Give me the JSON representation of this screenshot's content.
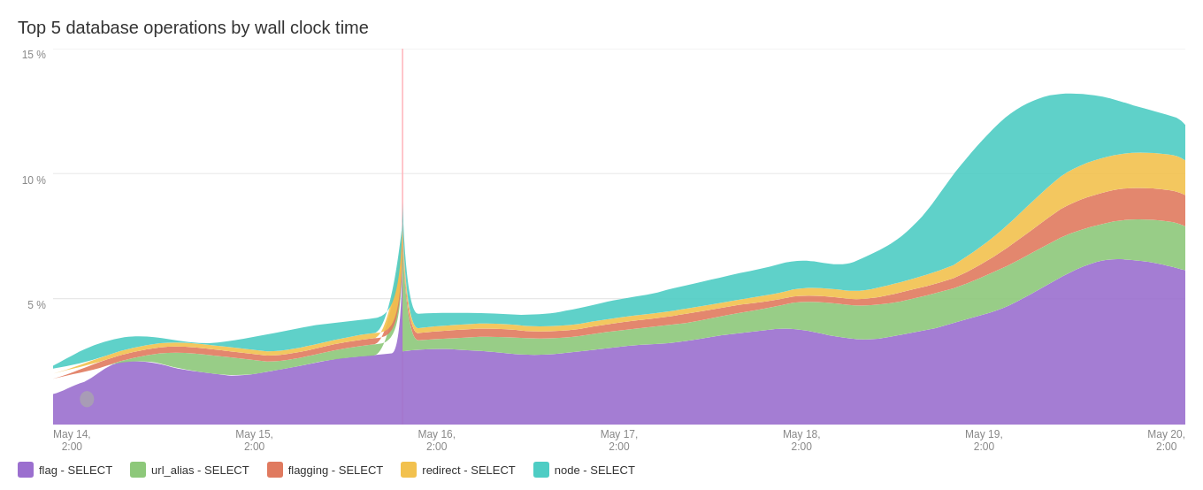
{
  "title": "Top 5 database operations by wall clock time",
  "yAxis": {
    "labels": [
      "15 %",
      "10 %",
      "5 %",
      ""
    ]
  },
  "xAxis": {
    "labels": [
      {
        "line1": "May 14,",
        "line2": "2:00"
      },
      {
        "line1": "May 15,",
        "line2": "2:00"
      },
      {
        "line1": "May 16,",
        "line2": "2:00"
      },
      {
        "line1": "May 17,",
        "line2": "2:00"
      },
      {
        "line1": "May 18,",
        "line2": "2:00"
      },
      {
        "line1": "May 19,",
        "line2": "2:00"
      },
      {
        "line1": "May 20,",
        "line2": "2:00"
      }
    ]
  },
  "legend": [
    {
      "label": "flag - SELECT",
      "color": "#9b6fcf"
    },
    {
      "label": "url_alias - SELECT",
      "color": "#8dc87a"
    },
    {
      "label": "flagging - SELECT",
      "color": "#e07a5f"
    },
    {
      "label": "redirect - SELECT",
      "color": "#f2c14e"
    },
    {
      "label": "node - SELECT",
      "color": "#4ecdc4"
    }
  ],
  "colors": {
    "purple": "#9b6fcf",
    "green": "#8dc87a",
    "orange": "#e07a5f",
    "yellow": "#f2c14e",
    "teal": "#4ecdc4",
    "spike": "#ffb3ba"
  }
}
